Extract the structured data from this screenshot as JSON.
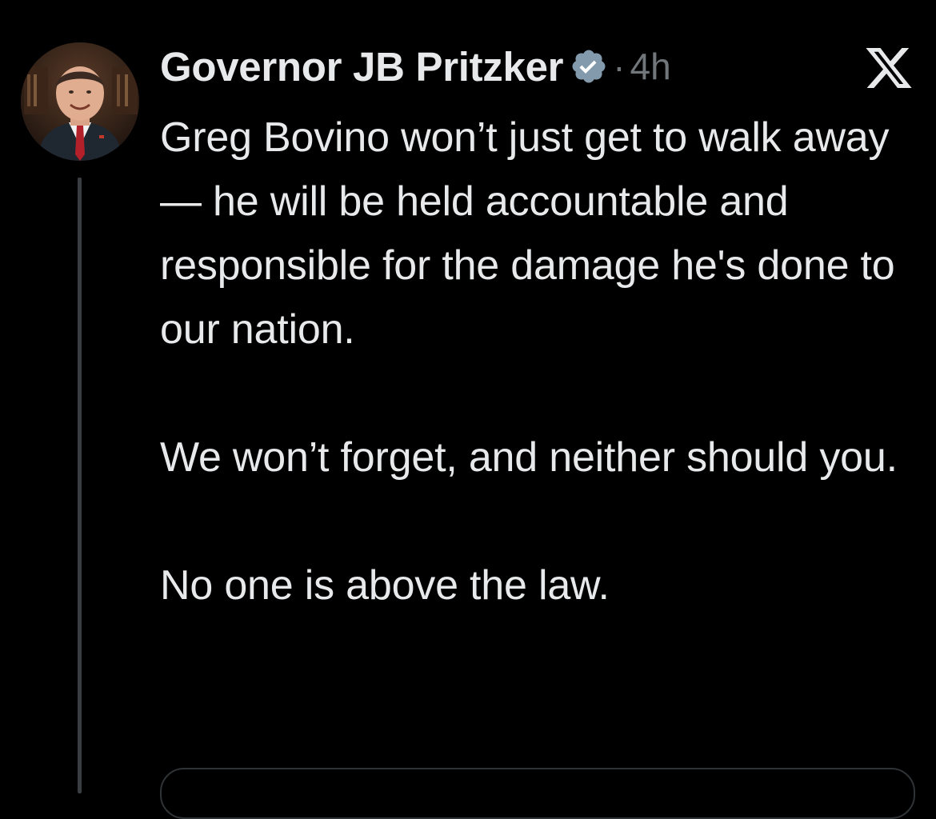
{
  "author": {
    "display_name": "Governor JB Pritzker",
    "verified_icon": "verified-badge-icon",
    "badge_color": "#829aab",
    "separator": "·",
    "timestamp": "4h"
  },
  "tweet": {
    "paragraphs": [
      "Greg Bovino won’t just get to walk away — he will be held accountable and responsible for the damage he's done to our nation.",
      "We won’t forget, and neither should you.",
      "No one is above the law."
    ]
  },
  "icons": {
    "close": "x-logo-icon"
  },
  "colors": {
    "background": "#000000",
    "text_primary": "#e7e9ea",
    "text_secondary": "#71767b",
    "thread_line": "#3a3d41"
  }
}
